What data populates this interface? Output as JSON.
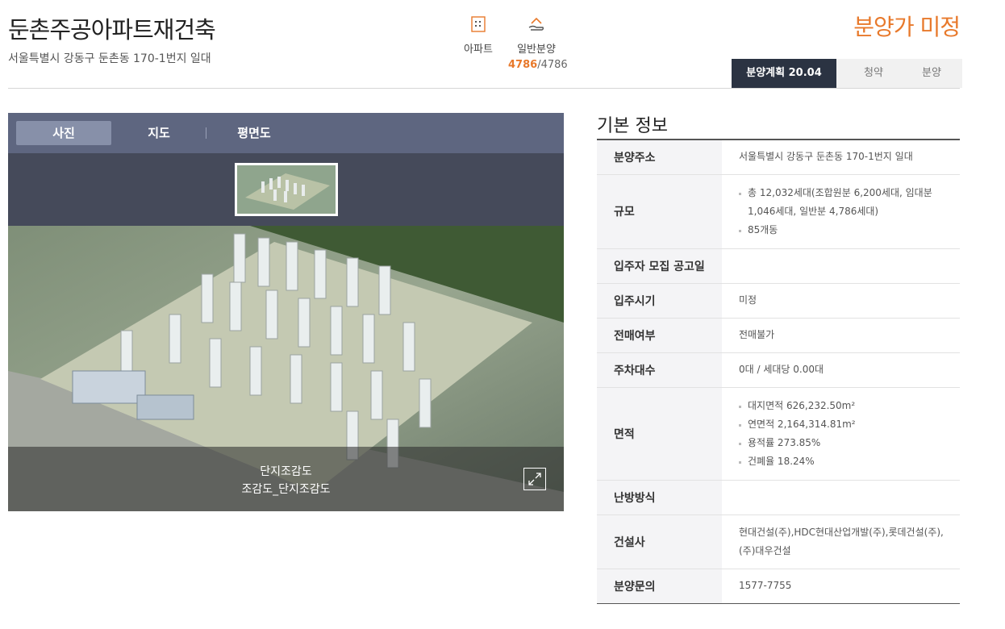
{
  "header": {
    "title": "둔촌주공아파트재건축",
    "address": "서울특별시 강동구 둔촌동 170-1번지 일대",
    "type_label": "아파트",
    "supply_label": "일반분양",
    "supply_current": "4786",
    "supply_total": "/4786",
    "price_status": "분양가 미정"
  },
  "steps": [
    {
      "label": "분양계획 20.04",
      "active": true
    },
    {
      "label": "청약",
      "active": false
    },
    {
      "label": "분양",
      "active": false
    }
  ],
  "gallery": {
    "tabs": [
      "사진",
      "지도",
      "평면도"
    ],
    "active_tab": "사진",
    "caption_line1": "단지조감도",
    "caption_line2": "조감도_단지조감도"
  },
  "info": {
    "section_title": "기본 정보",
    "rows": [
      {
        "label": "분양주소",
        "value": "서울특별시 강동구 둔촌동 170-1번지 일대"
      },
      {
        "label": "규모",
        "items": [
          "총 12,032세대(조합원분 6,200세대, 임대분 1,046세대, 일반분 4,786세대)",
          "85개동"
        ]
      },
      {
        "label": "입주자 모집 공고일",
        "value": ""
      },
      {
        "label": "입주시기",
        "value": "미정"
      },
      {
        "label": "전매여부",
        "value": "전매불가"
      },
      {
        "label": "주차대수",
        "value": "0대 / 세대당 0.00대"
      },
      {
        "label": "면적",
        "items": [
          "대지면적 626,232.50m²",
          "연면적 2,164,314.81m²",
          "용적률 273.85%",
          "건폐율 18.24%"
        ]
      },
      {
        "label": "난방방식",
        "value": ""
      },
      {
        "label": "건설사",
        "value": "현대건설(주),HDC현대산업개발(주),롯데건설(주),(주)대우건설"
      },
      {
        "label": "분양문의",
        "value": "1577-7755"
      }
    ]
  },
  "colors": {
    "accent": "#e8792b",
    "navy": "#2b3342",
    "tab_bar": "#5e6680"
  }
}
